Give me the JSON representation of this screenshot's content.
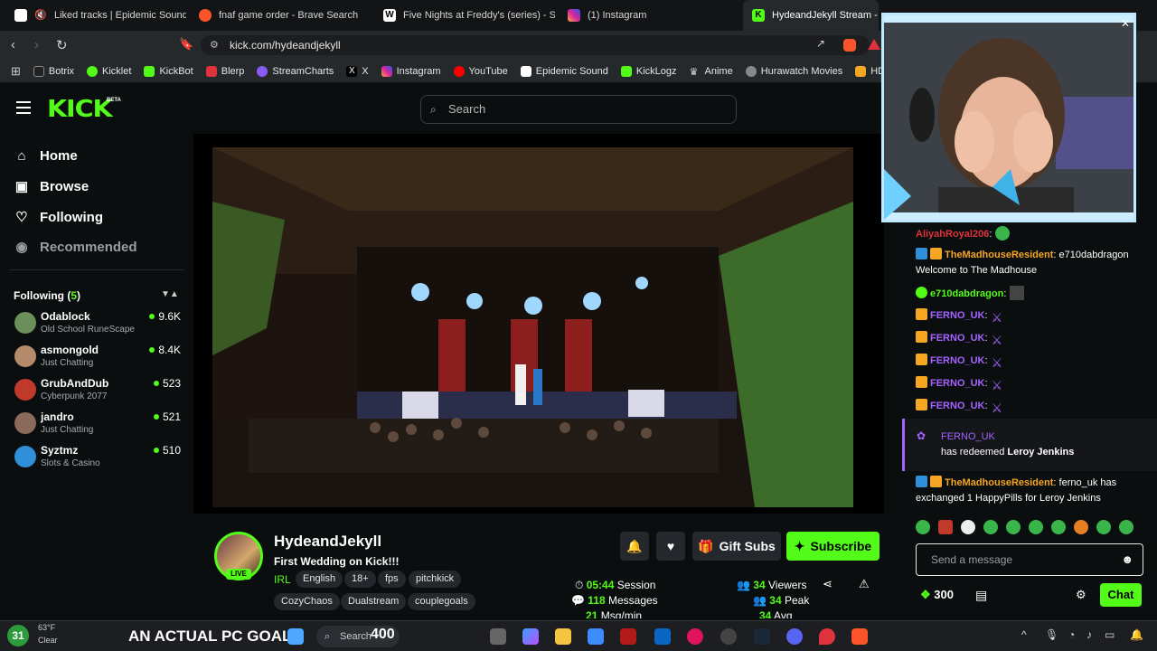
{
  "browser": {
    "tabs": [
      {
        "title": "Liked tracks | Epidemic Sound",
        "active": false
      },
      {
        "title": "fnaf game order - Brave Search",
        "active": false
      },
      {
        "title": "Five Nights at Freddy's (series) - Simp",
        "active": false
      },
      {
        "title": "(1) Instagram",
        "active": false
      },
      {
        "title": "HydeandJekyll Stream - W",
        "active": true
      }
    ],
    "url": "kick.com/hydeandjekyll",
    "bookmarks": [
      "Botrix",
      "Kicklet",
      "KickBot",
      "Blerp",
      "StreamCharts",
      "X",
      "Instagram",
      "YouTube",
      "Epidemic Sound",
      "KickLogz",
      "Anime",
      "Hurawatch Movies",
      "HDToday"
    ]
  },
  "kick": {
    "logo": "KICK",
    "beta": "BETA",
    "search_placeholder": "Search",
    "nav": {
      "home": "Home",
      "browse": "Browse",
      "following": "Following",
      "recommended": "Recommended"
    },
    "following_header": "Following (",
    "following_count": "5",
    "following_close": ")",
    "following_channels": [
      {
        "name": "Odablock",
        "category": "Old School RuneScape",
        "viewers": "9.6K",
        "color": "#6a8f5a"
      },
      {
        "name": "asmongold",
        "category": "Just Chatting",
        "viewers": "8.4K",
        "color": "#b48a6a"
      },
      {
        "name": "GrubAndDub",
        "category": "Cyberpunk 2077",
        "viewers": "523",
        "color": "#c0392b"
      },
      {
        "name": "jandro",
        "category": "Just Chatting",
        "viewers": "521",
        "color": "#8a6b5a"
      },
      {
        "name": "Syztmz",
        "category": "Slots & Casino",
        "viewers": "510",
        "color": "#2f8fd8"
      }
    ]
  },
  "stream": {
    "live_label": "LIVE",
    "streamer": "HydeandJekyll",
    "title": "First Wedding on Kick!!!",
    "category": "IRL",
    "tags": [
      "English",
      "18+",
      "fps",
      "pitchkick",
      "CozyChaos",
      "Dualstream",
      "couplegoals"
    ],
    "gift_subs": "Gift Subs",
    "subscribe": "Subscribe",
    "stats": {
      "session_value": "05:44",
      "session_label": "Session",
      "messages_value": "118",
      "messages_label": "Messages",
      "rate_value": "21",
      "rate_label": "Msg/min",
      "viewers_value": "34",
      "viewers_label": "Viewers",
      "peak_value": "34",
      "peak_label": "Peak",
      "avg_value": "34",
      "avg_label": "Avg"
    }
  },
  "chat": {
    "messages": [
      {
        "user": "AliyahRoyal206",
        "text": ":",
        "style": "red"
      },
      {
        "user": "TheMadhouseResident",
        "text": ": e710dabdragon Welcome to The Madhouse",
        "style": "orange"
      },
      {
        "user": "e710dabdragon",
        "text": ":",
        "style": "green"
      },
      {
        "user": "FERNO_UK",
        "text": ":",
        "style": "purple"
      },
      {
        "user": "FERNO_UK",
        "text": ":",
        "style": "purple"
      },
      {
        "user": "FERNO_UK",
        "text": ":",
        "style": "purple"
      },
      {
        "user": "FERNO_UK",
        "text": ":",
        "style": "purple"
      },
      {
        "user": "FERNO_UK",
        "text": ":",
        "style": "purple"
      }
    ],
    "redeem_user": "FERNO_UK",
    "redeem_text": "has redeemed ",
    "redeem_item": "Leroy Jenkins",
    "exchange_user": "TheMadhouseResident",
    "exchange_text": ": ferno_uk has exchanged 1 HappyPills for Leroy Jenkins",
    "input_placeholder": "Send a message",
    "points": "300",
    "chat_button": "Chat"
  },
  "taskbar": {
    "weather_num": "31",
    "temp": "63°F",
    "condition": "Clear",
    "goal_text": "AN ACTUAL PC GOAL",
    "goal_number": "400",
    "search": "Search"
  }
}
